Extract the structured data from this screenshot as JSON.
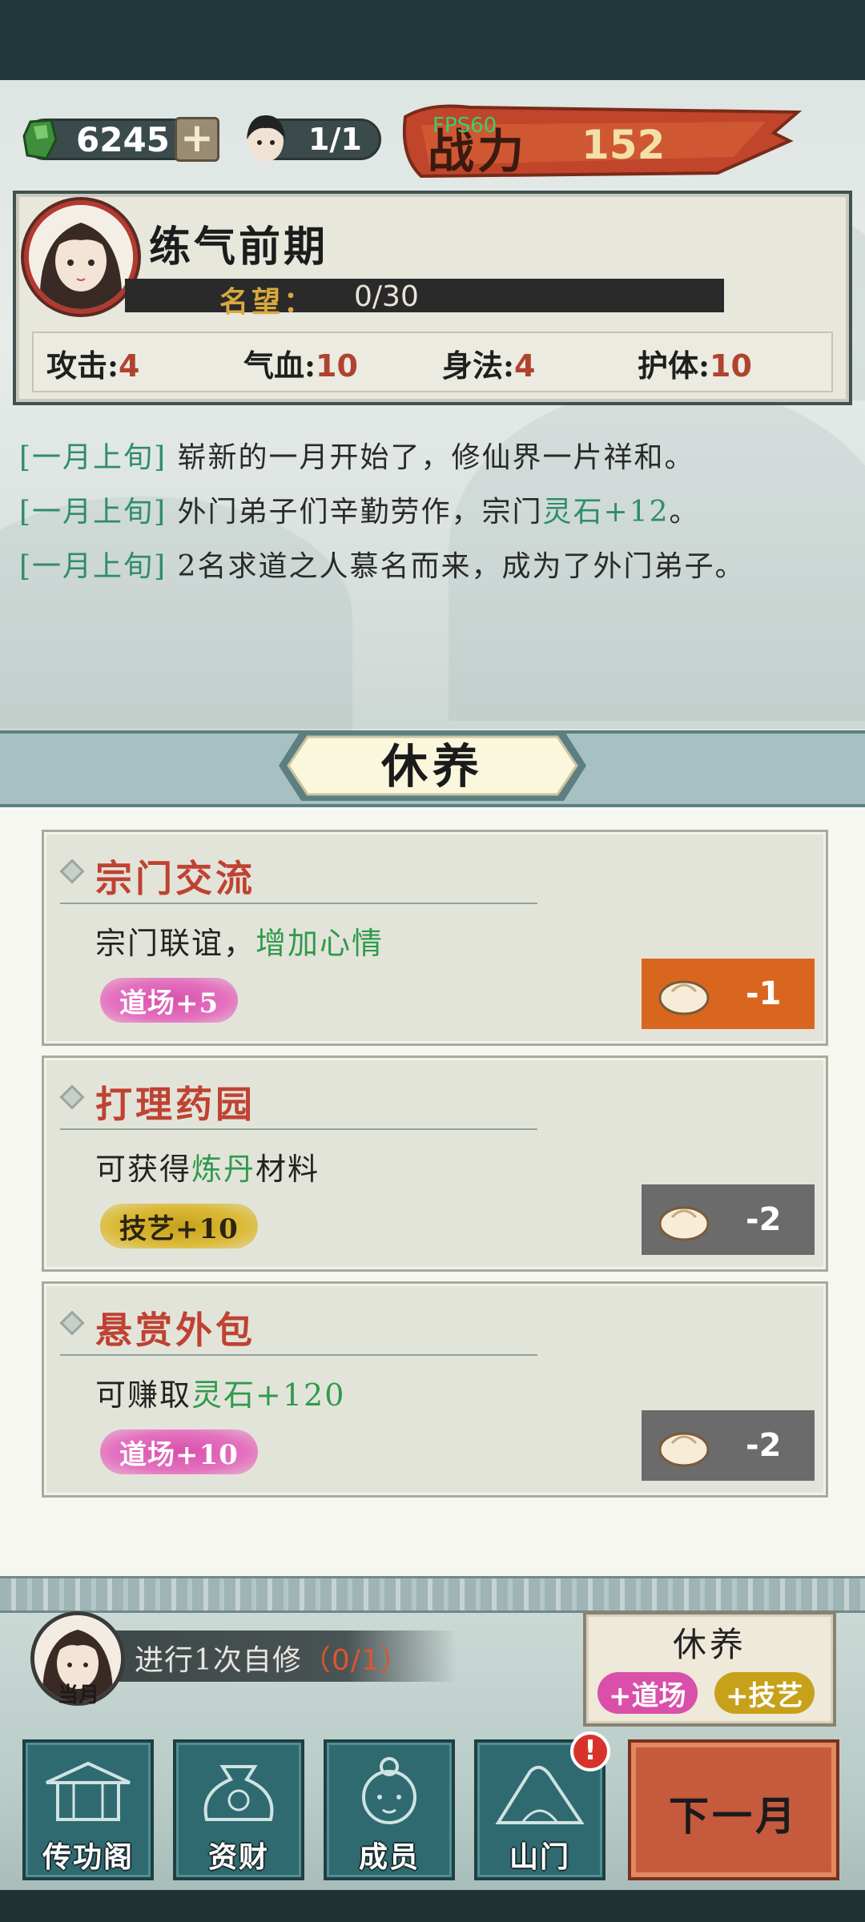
{
  "header": {
    "spirit_stones": "6245",
    "disciples": "1/1",
    "power_label": "战力",
    "power_value": "152",
    "fps": "FPS60"
  },
  "profile": {
    "realm": "练气前期",
    "prestige_label": "名望：",
    "prestige_value": "0/30",
    "stats": [
      {
        "label": "攻击:",
        "value": "4"
      },
      {
        "label": "气血:",
        "value": "10"
      },
      {
        "label": "身法:",
        "value": "4"
      },
      {
        "label": "护体:",
        "value": "10"
      }
    ]
  },
  "log": [
    {
      "date": "[一月上旬]",
      "text": " 崭新的一月开始了，修仙界一片祥和。",
      "hl": "",
      "tail": ""
    },
    {
      "date": "[一月上旬]",
      "text": " 外门弟子们辛勤劳作，宗门",
      "hl": "灵石+12",
      "tail": "。"
    },
    {
      "date": "[一月上旬]",
      "text": " 2名求道之人慕名而来，成为了外门弟子。",
      "hl": "",
      "tail": ""
    }
  ],
  "section_title": "休养",
  "activities": [
    {
      "title": "宗门交流",
      "desc": "宗门联谊，",
      "desc_hl": "增加心情",
      "desc_tail": "",
      "tag": "道场+5",
      "cost": "-1"
    },
    {
      "title": "打理药园",
      "desc": "可获得",
      "desc_hl": "炼丹",
      "desc_tail": "材料",
      "tag": "技艺+10",
      "cost": "-2"
    },
    {
      "title": "悬赏外包",
      "desc": "可赚取",
      "desc_hl": "灵石+120",
      "desc_tail": "",
      "tag": "道场+10",
      "cost": "-2"
    }
  ],
  "self_cultivation": {
    "text": "进行1次自修",
    "count": "（0/1）",
    "name": "当月"
  },
  "rest_card": {
    "title": "休养",
    "tag1": "+道场",
    "tag2": "+技艺"
  },
  "nav": {
    "items": [
      "传功阁",
      "资财",
      "成员",
      "山门"
    ],
    "alert": "!",
    "next": "下一月"
  },
  "colors": {
    "accent_red": "#bf4232",
    "accent_green": "#2f9a4d",
    "active_cost": "#d9661f",
    "inactive_cost": "#6b6b6b",
    "nav_teal": "#2f6a70"
  }
}
